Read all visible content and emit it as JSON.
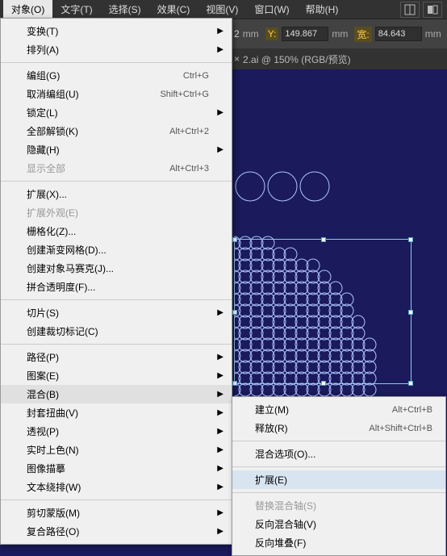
{
  "menubar": {
    "items": [
      "对象(O)",
      "文字(T)",
      "选择(S)",
      "效果(C)",
      "视图(V)",
      "窗口(W)",
      "帮助(H)"
    ]
  },
  "propbar": {
    "x_suffix": "2",
    "x_unit": "mm",
    "y_label": "Y:",
    "y_value": "149.867",
    "y_unit": "mm",
    "w_label": "宽:",
    "w_value": "84.643",
    "w_unit": "mm"
  },
  "tabbar": {
    "close": "×",
    "title": "2.ai @ 150% (RGB/预览)"
  },
  "dropdown": [
    {
      "label": "变换(T)",
      "sub": true
    },
    {
      "label": "排列(A)",
      "sub": true
    },
    {
      "sep": true
    },
    {
      "label": "编组(G)",
      "shortcut": "Ctrl+G"
    },
    {
      "label": "取消编组(U)",
      "shortcut": "Shift+Ctrl+G"
    },
    {
      "label": "锁定(L)",
      "sub": true
    },
    {
      "label": "全部解锁(K)",
      "shortcut": "Alt+Ctrl+2"
    },
    {
      "label": "隐藏(H)",
      "sub": true
    },
    {
      "label": "显示全部",
      "shortcut": "Alt+Ctrl+3",
      "disabled": true
    },
    {
      "sep": true
    },
    {
      "label": "扩展(X)..."
    },
    {
      "label": "扩展外观(E)",
      "disabled": true
    },
    {
      "label": "栅格化(Z)..."
    },
    {
      "label": "创建渐变网格(D)..."
    },
    {
      "label": "创建对象马赛克(J)..."
    },
    {
      "label": "拼合透明度(F)..."
    },
    {
      "sep": true
    },
    {
      "label": "切片(S)",
      "sub": true
    },
    {
      "label": "创建裁切标记(C)"
    },
    {
      "sep": true
    },
    {
      "label": "路径(P)",
      "sub": true
    },
    {
      "label": "图案(E)",
      "sub": true
    },
    {
      "label": "混合(B)",
      "sub": true,
      "highlight": true
    },
    {
      "label": "封套扭曲(V)",
      "sub": true
    },
    {
      "label": "透视(P)",
      "sub": true
    },
    {
      "label": "实时上色(N)",
      "sub": true
    },
    {
      "label": "图像描摹",
      "sub": true
    },
    {
      "label": "文本绕排(W)",
      "sub": true
    },
    {
      "sep": true
    },
    {
      "label": "剪切蒙版(M)",
      "sub": true
    },
    {
      "label": "复合路径(O)",
      "sub": true
    }
  ],
  "submenu": [
    {
      "label": "建立(M)",
      "shortcut": "Alt+Ctrl+B"
    },
    {
      "label": "释放(R)",
      "shortcut": "Alt+Shift+Ctrl+B"
    },
    {
      "sep": true
    },
    {
      "label": "混合选项(O)..."
    },
    {
      "sep": true
    },
    {
      "label": "扩展(E)",
      "highlight": true
    },
    {
      "sep": true
    },
    {
      "label": "替换混合轴(S)",
      "disabled": true
    },
    {
      "label": "反向混合轴(V)"
    },
    {
      "label": "反向堆叠(F)"
    }
  ]
}
